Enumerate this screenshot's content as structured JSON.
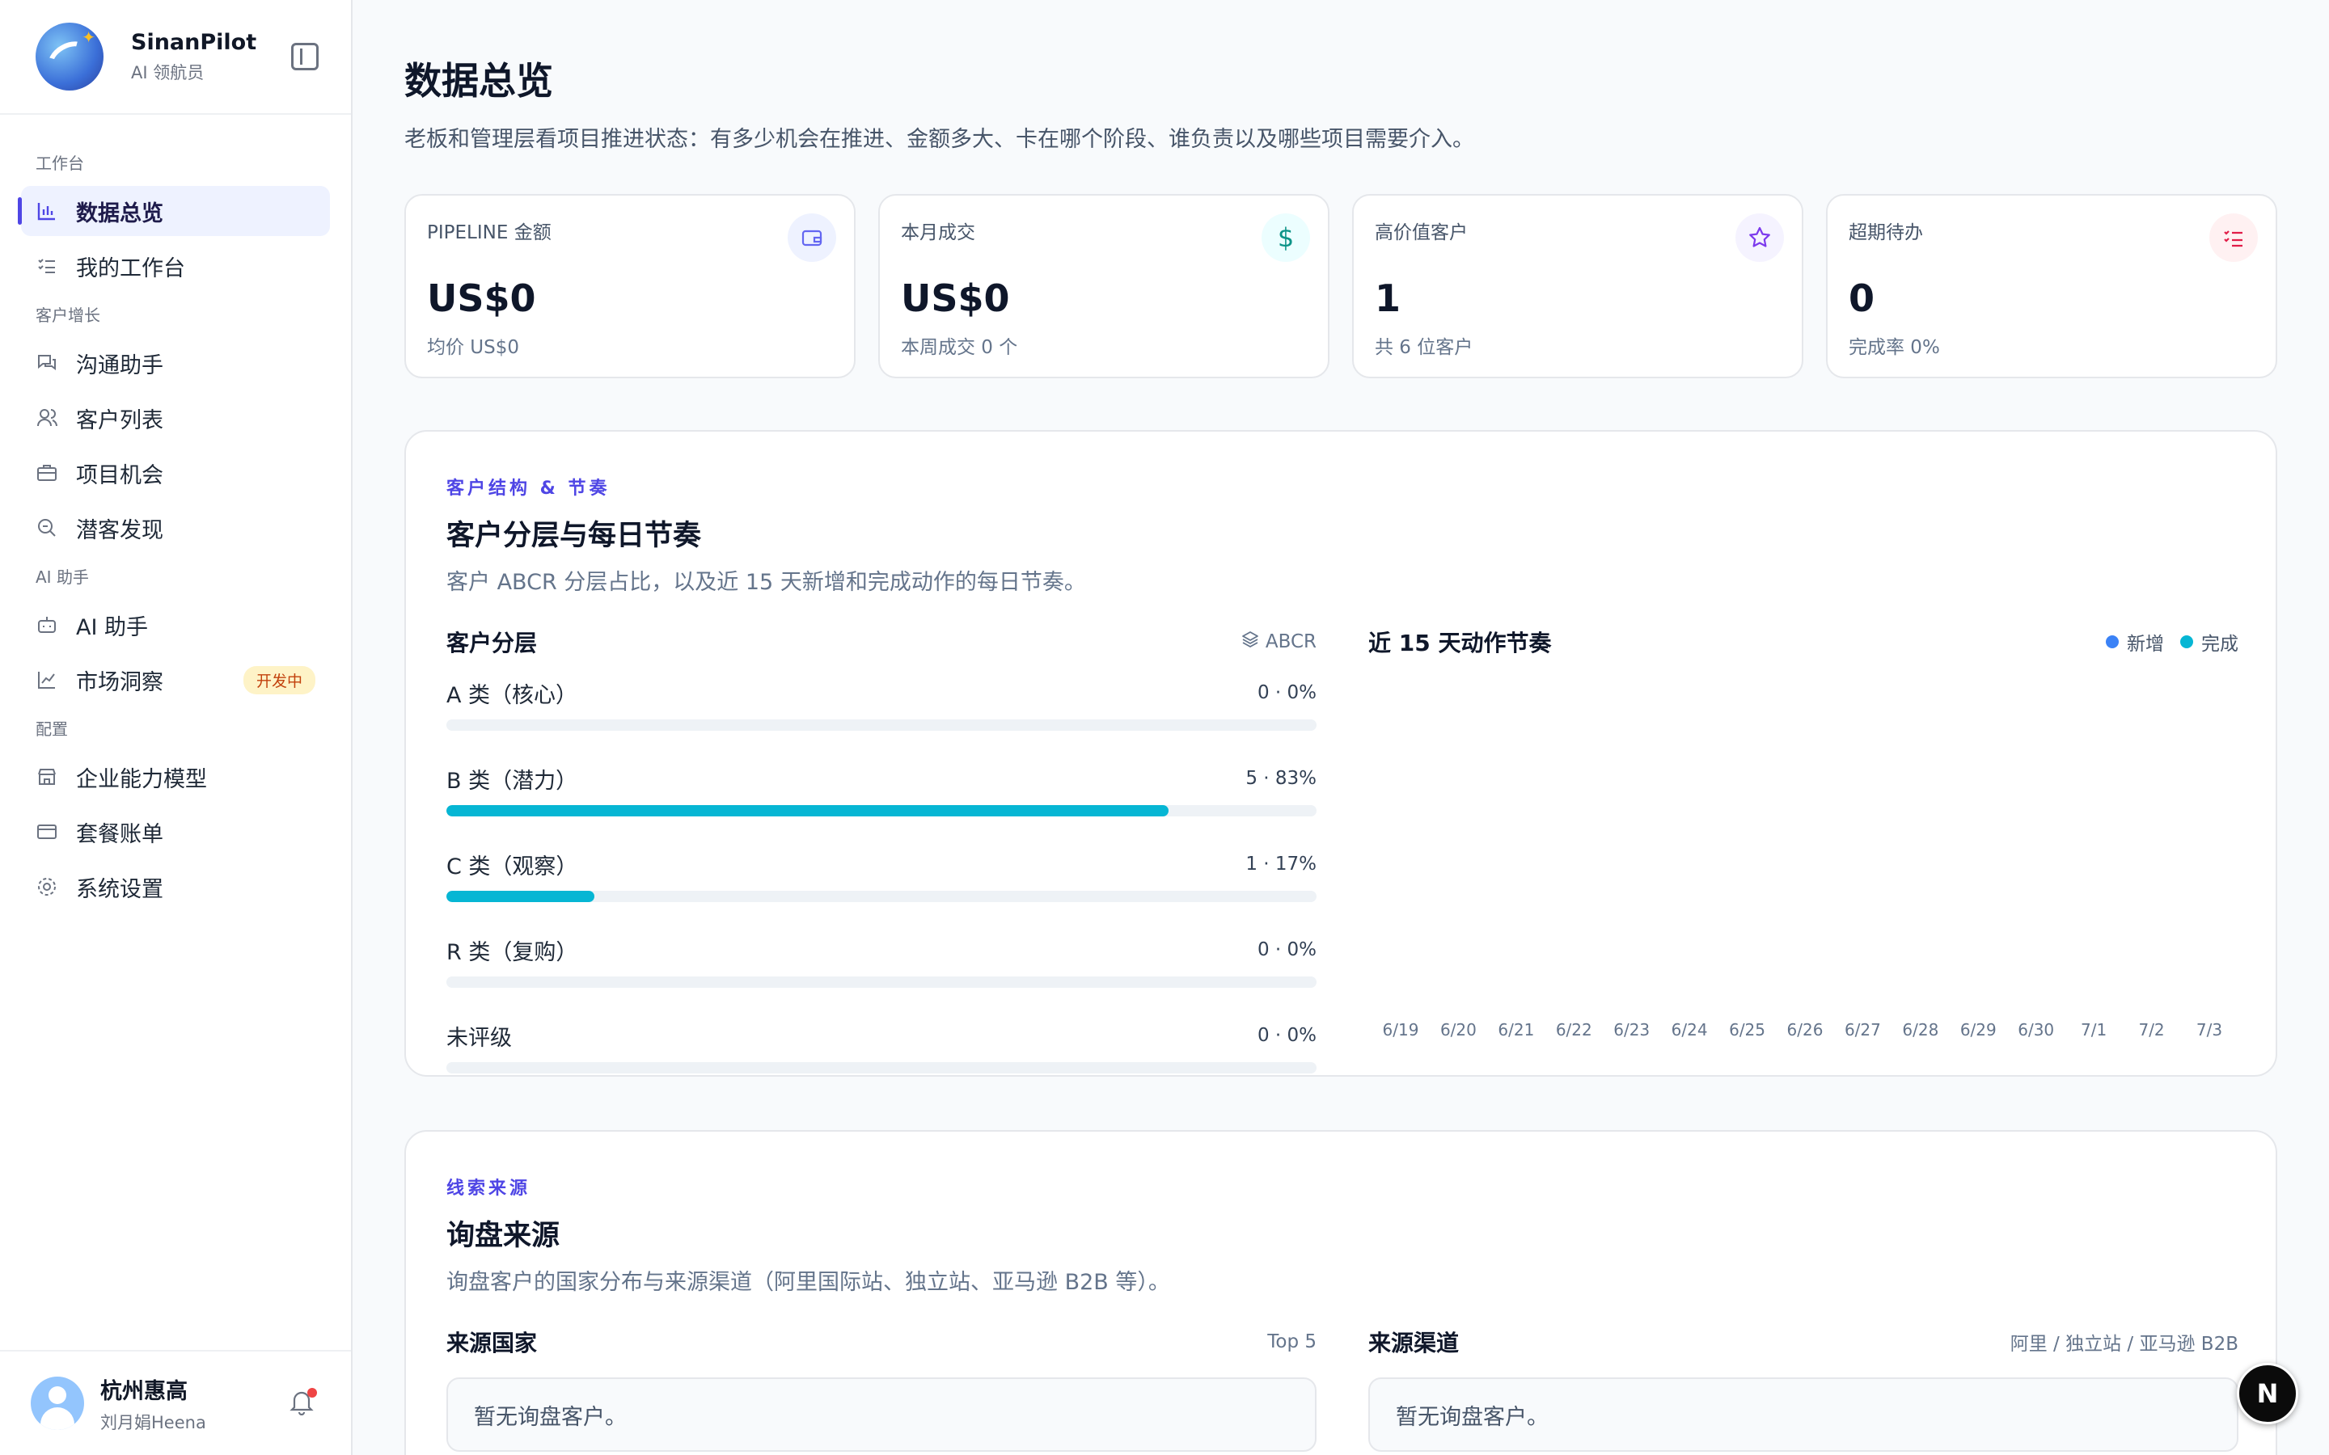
{
  "brand": {
    "name": "SinanPilot",
    "subtitle": "AI 领航员"
  },
  "sidebar": {
    "groups": [
      {
        "label": "工作台",
        "items": [
          {
            "label": "数据总览",
            "icon": "bar-chart-icon",
            "active": true
          },
          {
            "label": "我的工作台",
            "icon": "list-check-icon"
          }
        ]
      },
      {
        "label": "客户增长",
        "items": [
          {
            "label": "沟通助手",
            "icon": "chat-icon"
          },
          {
            "label": "客户列表",
            "icon": "users-icon"
          },
          {
            "label": "项目机会",
            "icon": "briefcase-icon"
          },
          {
            "label": "潜客发现",
            "icon": "search-icon"
          }
        ]
      },
      {
        "label": "AI 助手",
        "items": [
          {
            "label": "AI 助手",
            "icon": "robot-icon"
          },
          {
            "label": "市场洞察",
            "icon": "line-chart-icon",
            "badge": "开发中"
          }
        ]
      },
      {
        "label": "配置",
        "items": [
          {
            "label": "企业能力模型",
            "icon": "store-icon"
          },
          {
            "label": "套餐账单",
            "icon": "credit-card-icon"
          },
          {
            "label": "系统设置",
            "icon": "gear-icon"
          }
        ]
      }
    ]
  },
  "user": {
    "name": "杭州惠高",
    "subtitle": "刘月娟Heena"
  },
  "page": {
    "title": "数据总览",
    "description": "老板和管理层看项目推进状态：有多少机会在推进、金额多大、卡在哪个阶段、谁负责以及哪些项目需要介入。"
  },
  "kpis": [
    {
      "label": "PIPELINE 金额",
      "value": "US$0",
      "sub": "均价 US$0",
      "icon": "wallet-icon",
      "color": "#6366f1",
      "bg": "#eef2ff"
    },
    {
      "label": "本月成交",
      "value": "US$0",
      "sub": "本周成交 0 个",
      "icon": "dollar-icon",
      "color": "#0d9488",
      "bg": "#ecfeff"
    },
    {
      "label": "高价值客户",
      "value": "1",
      "sub": "共 6 位客户",
      "icon": "star-icon",
      "color": "#7c3aed",
      "bg": "#f5f3ff"
    },
    {
      "label": "超期待办",
      "value": "0",
      "sub": "完成率 0%",
      "icon": "todo-list-icon",
      "color": "#e11d48",
      "bg": "#fff1f2"
    }
  ],
  "structure": {
    "eyebrow": "客户结构 & 节奏",
    "title": "客户分层与每日节奏",
    "description": "客户 ABCR 分层占比，以及近 15 天新增和完成动作的每日节奏。",
    "segments": {
      "title": "客户分层",
      "tag": "ABCR",
      "rows": [
        {
          "label": "A 类（核心）",
          "value": "0 · 0%",
          "ratio": 0
        },
        {
          "label": "B 类（潜力）",
          "value": "5 · 83%",
          "ratio": 0.83
        },
        {
          "label": "C 类（观察）",
          "value": "1 · 17%",
          "ratio": 0.17
        },
        {
          "label": "R 类（复购）",
          "value": "0 · 0%",
          "ratio": 0
        },
        {
          "label": "未评级",
          "value": "0 · 0%",
          "ratio": 0
        }
      ]
    },
    "rhythm": {
      "title": "近 15 天动作节奏",
      "legend": [
        {
          "label": "新增",
          "color": "#3b82f6"
        },
        {
          "label": "完成",
          "color": "#06b6d4"
        }
      ],
      "dates": [
        "6/19",
        "6/20",
        "6/21",
        "6/22",
        "6/23",
        "6/24",
        "6/25",
        "6/26",
        "6/27",
        "6/28",
        "6/29",
        "6/30",
        "7/1",
        "7/2",
        "7/3"
      ]
    }
  },
  "sources": {
    "eyebrow": "线索来源",
    "title": "询盘来源",
    "description": "询盘客户的国家分布与来源渠道（阿里国际站、独立站、亚马逊 B2B 等）。",
    "country": {
      "title": "来源国家",
      "tag": "Top 5",
      "empty": "暂无询盘客户。"
    },
    "channel": {
      "title": "来源渠道",
      "tag": "阿里 / 独立站 / 亚马逊 B2B",
      "empty": "暂无询盘客户。"
    }
  },
  "floating_button": {
    "label": "N"
  }
}
